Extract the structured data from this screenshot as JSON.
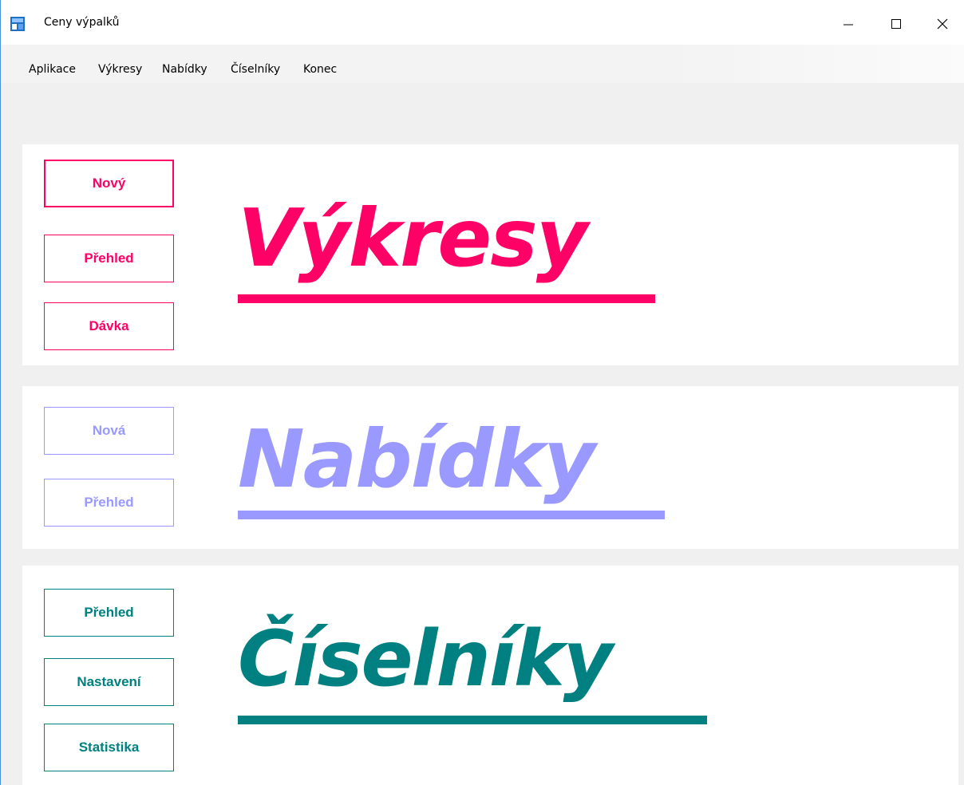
{
  "window": {
    "title": "Ceny výpalků"
  },
  "menu": [
    "Aplikace",
    "Výkresy",
    "Nabídky",
    "Číselníky",
    "Konec"
  ],
  "sections": {
    "vykresy": {
      "title": "Výkresy",
      "color": "#ff0066",
      "buttons": [
        "Nový",
        "Přehled",
        "Dávka"
      ]
    },
    "nabidky": {
      "title": "Nabídky",
      "color": "#9999ff",
      "buttons": [
        "Nová",
        "Přehled"
      ]
    },
    "ciselniky": {
      "title": "Číselníky",
      "color": "#008080",
      "buttons": [
        "Přehled",
        "Nastavení",
        "Statistika"
      ]
    }
  },
  "icons": {
    "app": "app-icon",
    "minimize": "minimize-icon",
    "maximize": "maximize-icon",
    "close": "close-icon"
  }
}
